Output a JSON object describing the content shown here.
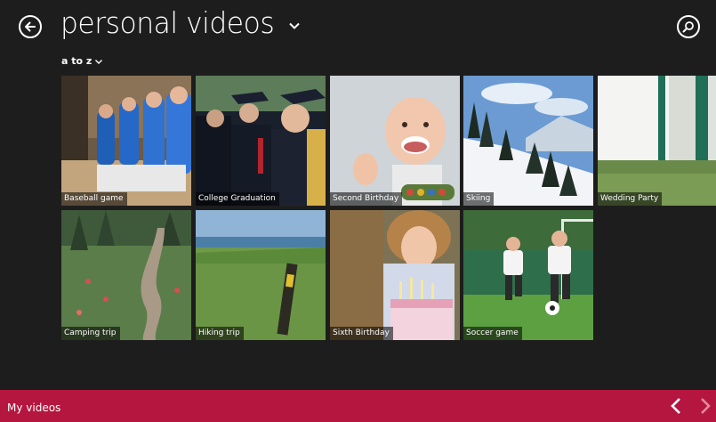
{
  "header": {
    "title": "personal videos",
    "back_icon": "back-arrow-icon",
    "search_icon": "search-icon"
  },
  "sort": {
    "label": "a to z"
  },
  "videos": [
    {
      "label": "Baseball game"
    },
    {
      "label": "College Graduation"
    },
    {
      "label": "Second Birthday"
    },
    {
      "label": "Skiing"
    },
    {
      "label": "Wedding Party"
    },
    {
      "label": "Camping trip"
    },
    {
      "label": "Hiking trip"
    },
    {
      "label": "Sixth Birthday"
    },
    {
      "label": "Soccer game"
    }
  ],
  "app_bar": {
    "label": "My videos",
    "color": "#b5163f"
  },
  "colors": {
    "background": "#1d1d1d",
    "accent": "#b5163f"
  }
}
